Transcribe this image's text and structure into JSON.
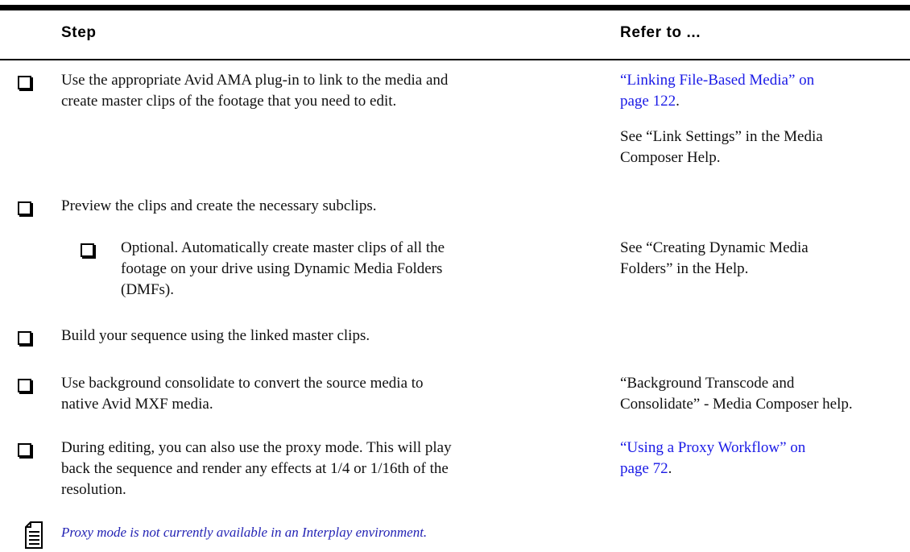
{
  "header": {
    "step_label": "Step",
    "refer_label": "Refer to ..."
  },
  "rows": [
    {
      "step_line1": "Use the appropriate Avid AMA plug-in to link to the media and",
      "step_line2": "create master clips of the footage that you need to edit.",
      "ref_link_line1": "“Linking File-Based Media” on",
      "ref_link_line2": "page 122",
      "ref_suffix": ".",
      "ref2_line1": "See “Link Settings” in the Media",
      "ref2_line2": "Composer Help."
    },
    {
      "step_line1": "Preview the clips and create the necessary subclips."
    },
    {
      "step_line1": "Optional. Automatically create master clips of all the",
      "step_line2": "footage on your drive using Dynamic Media Folders",
      "step_line3": "(DMFs).",
      "ref_line1": "See “Creating Dynamic Media",
      "ref_line2": "Folders” in the Help."
    },
    {
      "step_line1": "Build your sequence using the linked master clips."
    },
    {
      "step_line1": "Use background consolidate to convert the source media to",
      "step_line2": "native Avid MXF media.",
      "ref_line1": "“Background Transcode and",
      "ref_line2": "Consolidate” - Media Composer help."
    },
    {
      "step_line1": "During editing, you can also use the proxy mode. This will play",
      "step_line2": "back the sequence and render any effects at 1/4 or 1/16th of the",
      "step_line3": "resolution.",
      "ref_link_line1": "“Using a Proxy Workflow” on",
      "ref_link_line2": "page 72",
      "ref_suffix": "."
    }
  ],
  "note": {
    "icon": "note-icon",
    "text": "Proxy mode is not currently available in an Interplay environment."
  },
  "colors": {
    "link": "#1a1ae6",
    "note": "#2323b4"
  }
}
